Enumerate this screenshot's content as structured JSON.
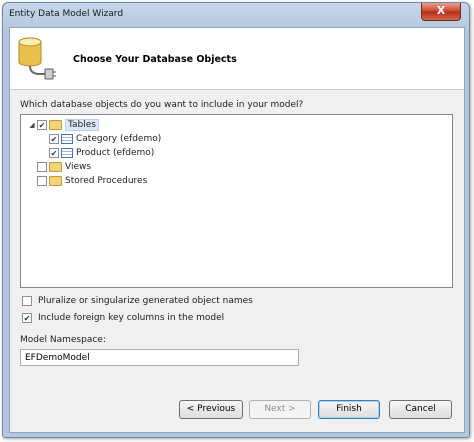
{
  "window": {
    "title": "Entity Data Model Wizard",
    "close_glyph": "X"
  },
  "header": {
    "title": "Choose Your Database Objects",
    "icon": "database-plug-icon"
  },
  "question": "Which database objects do you want to include in your model?",
  "tree": {
    "tables": {
      "label": "Tables",
      "checked": true,
      "children": [
        {
          "label": "Category (efdemo)",
          "checked": true
        },
        {
          "label": "Product (efdemo)",
          "checked": true
        }
      ]
    },
    "views": {
      "label": "Views",
      "checked": false
    },
    "procedures": {
      "label": "Stored Procedures",
      "checked": false
    }
  },
  "options": {
    "pluralize": {
      "label": "Pluralize or singularize generated object names",
      "checked": false
    },
    "foreign_keys": {
      "label": "Include foreign key columns in the model",
      "checked": true
    }
  },
  "namespace": {
    "label": "Model Namespace:",
    "value": "EFDemoModel"
  },
  "buttons": {
    "previous": "< Previous",
    "next": "Next >",
    "finish": "Finish",
    "cancel": "Cancel"
  }
}
